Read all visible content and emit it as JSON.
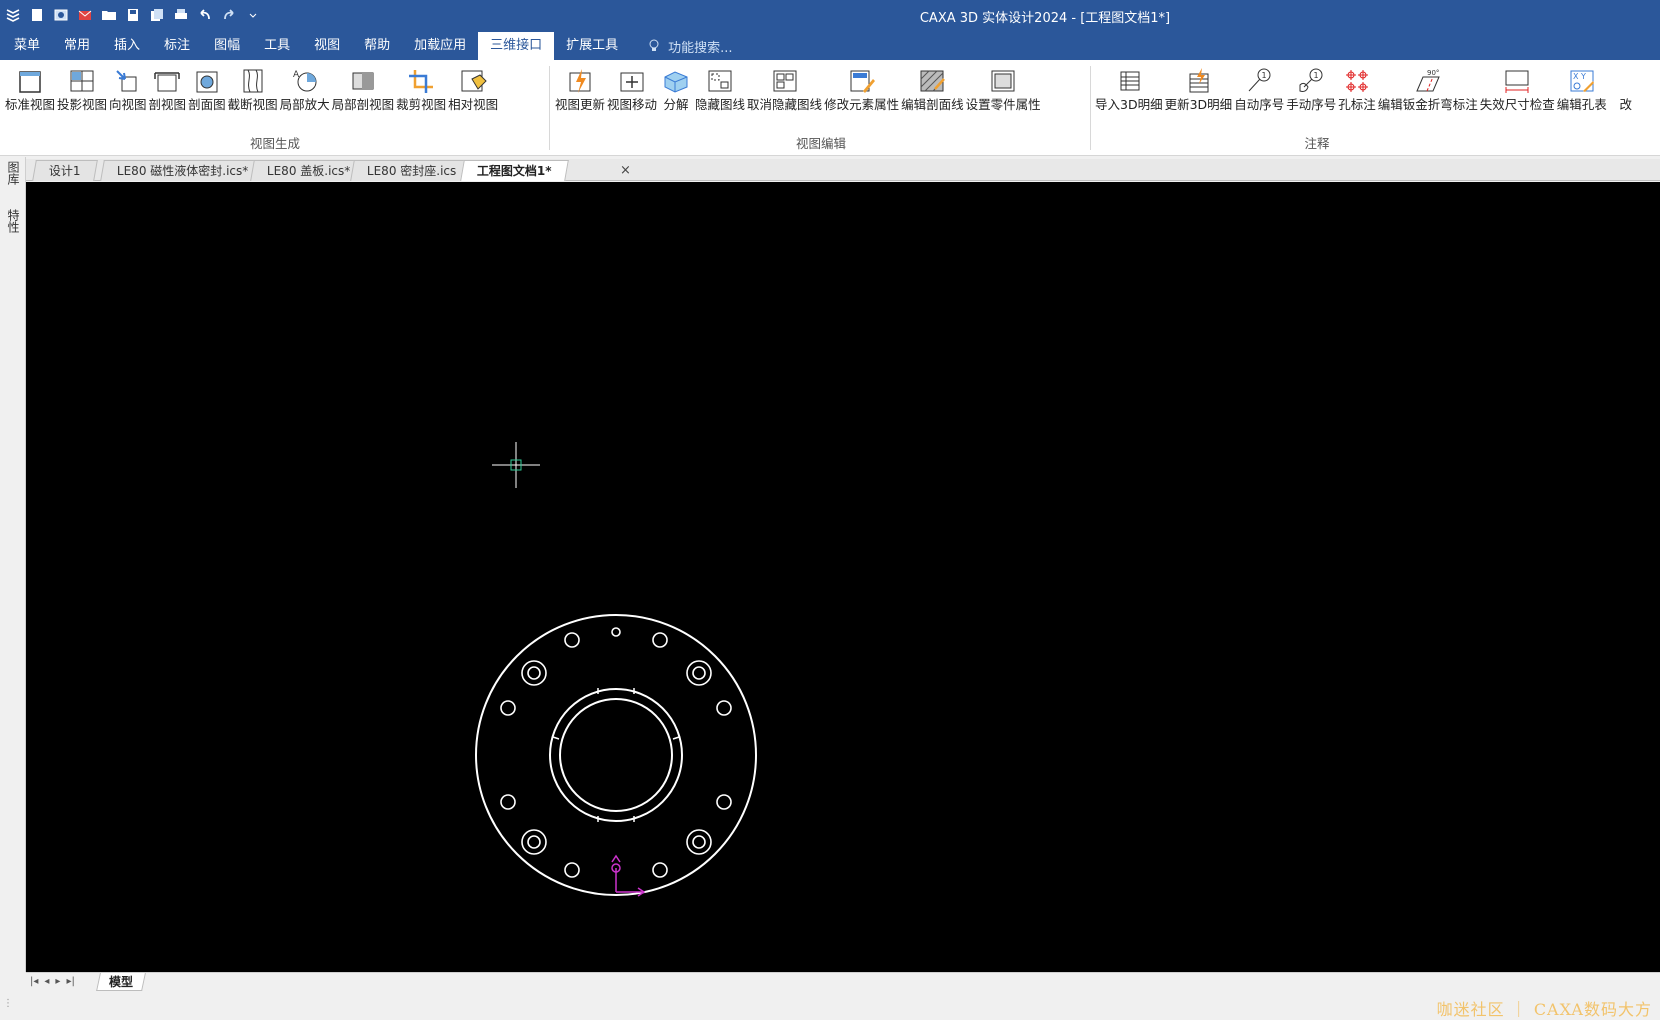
{
  "window": {
    "title": "CAXA 3D 实体设计2024 - [工程图文档1*]"
  },
  "quick_access": [
    "app-logo-icon",
    "new-icon",
    "open-icon",
    "mail-icon",
    "folder-icon",
    "save-icon",
    "save-all-icon",
    "print-icon",
    "undo-icon",
    "redo-icon",
    "customize-icon"
  ],
  "menu": {
    "tabs": [
      "菜单",
      "常用",
      "插入",
      "标注",
      "图幅",
      "工具",
      "视图",
      "帮助",
      "加载应用",
      "三维接口",
      "扩展工具"
    ],
    "active": "三维接口",
    "search_placeholder": "功能搜索..."
  },
  "ribbon": {
    "groups": [
      {
        "label": "视图生成",
        "tools": [
          "标准视图",
          "投影视图",
          "向视图",
          "剖视图",
          "剖面图",
          "截断视图",
          "局部放大",
          "局部剖视图",
          "裁剪视图",
          "相对视图"
        ]
      },
      {
        "label": "视图编辑",
        "tools": [
          "视图更新",
          "视图移动",
          "分解",
          "隐藏图线",
          "取消隐藏图线",
          "修改元素属性",
          "编辑剖面线",
          "设置零件属性"
        ]
      },
      {
        "label": "注释",
        "tools": [
          "导入3D明细",
          "更新3D明细",
          "自动序号",
          "手动序号",
          "孔标注",
          "编辑钣金折弯标注",
          "失效尺寸检查",
          "编辑孔表",
          "改"
        ]
      }
    ]
  },
  "left_panel": {
    "tabs": [
      "图库",
      "特性"
    ]
  },
  "doc_tabs": [
    "设计1",
    "LE80 磁性液体密封.ics*",
    "LE80 盖板.ics*",
    "LE80 密封座.ics",
    "工程图文档1*"
  ],
  "active_doc": "工程图文档1*",
  "sheet": {
    "tabs": [
      "模型"
    ]
  },
  "status": {
    "watermark": "咖迷社区 ｜ CAXA数码大方"
  },
  "colors": {
    "title_bar": "#2b579a",
    "canvas": "#000000",
    "crosshair": "#ffffff",
    "cursor_box": "#33cc99",
    "axis": "#cc33cc",
    "drawing": "#ffffff"
  }
}
